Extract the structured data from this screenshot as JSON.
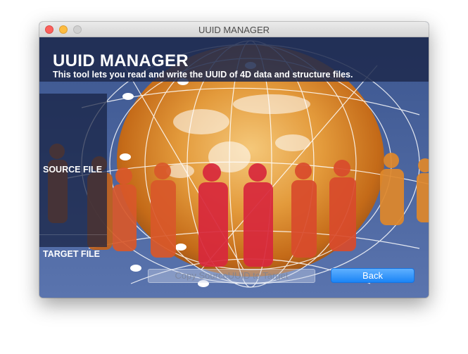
{
  "window": {
    "title": "UUID MANAGER"
  },
  "header": {
    "title": "UUID MANAGER",
    "subtitle": "This tool lets you read and write the UUID of 4D data and structure files."
  },
  "fields": {
    "source_label": "SOURCE FILE",
    "target_label": "TARGET FILE"
  },
  "buttons": {
    "copy_label": "Copy SourceUUID to Target",
    "copy_enabled": false,
    "back_label": "Back"
  },
  "icons": {
    "close": "close-dot-icon",
    "minimize": "minimize-dot-icon",
    "zoom": "zoom-dot-icon"
  },
  "colors": {
    "background": "#4e6aa6",
    "header_band": "#1e2a4e",
    "globe_orange": "#e08a2a",
    "people_red": "#d8283c",
    "back_button": "#1a84f6",
    "close_dot": "#fc605c",
    "minimize_dot": "#fdbc40",
    "zoom_dot": "#d0d0d0"
  }
}
